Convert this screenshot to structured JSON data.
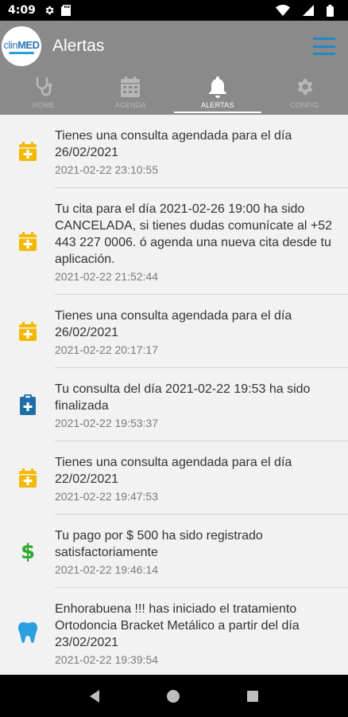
{
  "status_bar": {
    "time": "4:09"
  },
  "app": {
    "logo_text_clin": "clin",
    "logo_text_med": "MED",
    "title": "Alertas",
    "accent_color": "#1e88c8"
  },
  "tabs": [
    {
      "label": "HOME",
      "icon": "stethoscope-icon",
      "active": false
    },
    {
      "label": "AGENDA",
      "icon": "calendar-icon",
      "active": false
    },
    {
      "label": "ALERTAS",
      "icon": "bell-icon",
      "active": true
    },
    {
      "label": "CONFIG",
      "icon": "gear-icon",
      "active": false
    }
  ],
  "alerts": [
    {
      "icon": "calendar-plus-icon",
      "color": "#f5b800",
      "message": "Tienes una consulta agendada para el día 26/02/2021",
      "date": "2021-02-22 23:10:55"
    },
    {
      "icon": "calendar-plus-icon",
      "color": "#f5b800",
      "message": "Tu cita para el día 2021-02-26 19:00 ha sido CANCELADA, si tienes dudas comunícate al +52 443 227 0006. ó agenda una nueva cita desde tu aplicación.",
      "date": "2021-02-22 21:52:44"
    },
    {
      "icon": "calendar-plus-icon",
      "color": "#f5b800",
      "message": "Tienes una consulta agendada para el día 26/02/2021",
      "date": "2021-02-22 20:17:17"
    },
    {
      "icon": "clipboard-plus-icon",
      "color": "#1e6fa8",
      "message": "Tu consulta del día 2021-02-22 19:53 ha sido finalizada",
      "date": "2021-02-22 19:53:37"
    },
    {
      "icon": "calendar-plus-icon",
      "color": "#f5b800",
      "message": "Tienes una consulta agendada para el día 22/02/2021",
      "date": "2021-02-22 19:47:53"
    },
    {
      "icon": "dollar-icon",
      "color": "#2ea82e",
      "message": "Tu pago por $ 500 ha sido registrado satisfactoriamente",
      "date": "2021-02-22 19:46:14"
    },
    {
      "icon": "tooth-icon",
      "color": "#2b9fe0",
      "message": "Enhorabuena !!! has iniciado el tratamiento Ortodoncia Bracket Metálico a partir del día 23/02/2021",
      "date": "2021-02-22 19:39:54"
    }
  ]
}
